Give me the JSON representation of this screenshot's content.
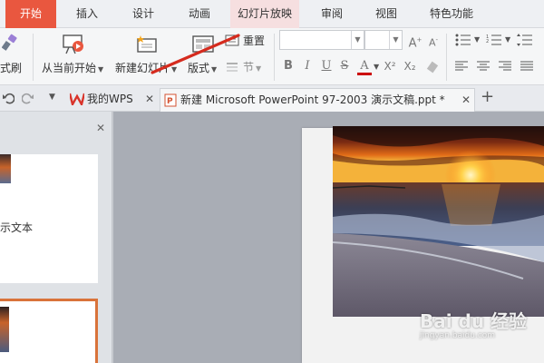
{
  "menu": {
    "tabs": [
      {
        "label": "开始"
      },
      {
        "label": "插入"
      },
      {
        "label": "设计"
      },
      {
        "label": "动画"
      },
      {
        "label": "幻灯片放映"
      },
      {
        "label": "审阅"
      },
      {
        "label": "视图"
      },
      {
        "label": "特色功能"
      }
    ]
  },
  "ribbon": {
    "format_painter": "式刷",
    "from_current": "从当前开始",
    "new_slide": "新建幻灯片",
    "layout": "版式",
    "reset": "重置",
    "section": "节",
    "font_buttons": [
      "B",
      "I",
      "U",
      "S",
      "A",
      "X²",
      "X₂"
    ]
  },
  "tabsbar": {
    "wps_tab": "我的WPS",
    "doc_tab": "新建 Microsoft PowerPoint 97-2003 演示文稿.ppt *",
    "new_tab": "+"
  },
  "slides_panel": {
    "thumb_text": "示文本"
  },
  "watermark": {
    "logo": "Bai du 经验",
    "url": "jingyan.baidu.com"
  },
  "colors": {
    "accent": "#e9573f",
    "annotation": "#d52b1e"
  }
}
